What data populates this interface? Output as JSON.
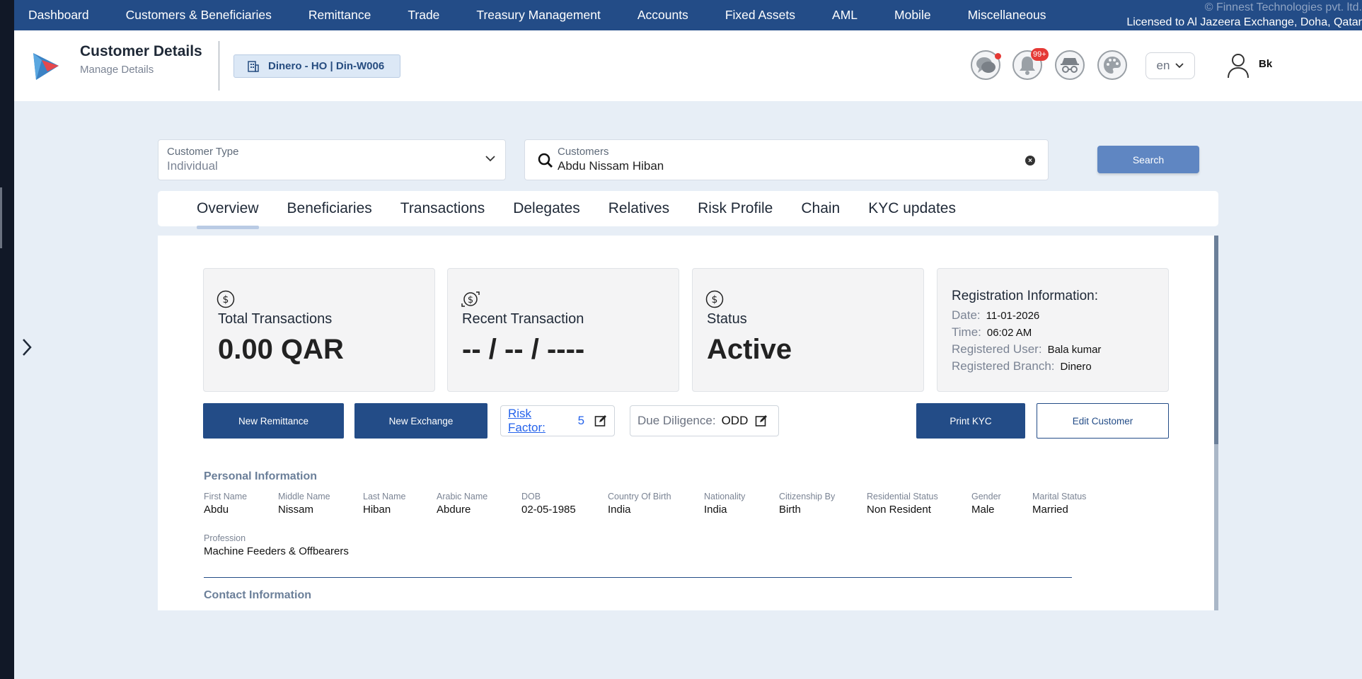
{
  "nav": {
    "items": [
      "Dashboard",
      "Customers & Beneficiaries",
      "Remittance",
      "Trade",
      "Treasury Management",
      "Accounts",
      "Fixed Assets",
      "AML",
      "Mobile",
      "Miscellaneous"
    ],
    "copyright": "©  Finnest Technologies pvt. ltd.",
    "license": "Licensed to Al Jazeera Exchange, Doha, Qatar"
  },
  "header": {
    "title": "Customer Details",
    "subtitle": "Manage Details",
    "branch": "Dinero - HO | Din-W006",
    "notification_badge": "99+",
    "language": "en",
    "user": "Bk"
  },
  "search": {
    "customer_type_label": "Customer Type",
    "customer_type_value": "Individual",
    "customers_label": "Customers",
    "customers_value": "Abdu Nissam Hiban",
    "button": "Search"
  },
  "tabs": [
    "Overview",
    "Beneficiaries",
    "Transactions",
    "Delegates",
    "Relatives",
    "Risk Profile",
    "Chain",
    "KYC updates"
  ],
  "cards": {
    "total": {
      "title": "Total Transactions",
      "value": "0.00 QAR"
    },
    "recent": {
      "title": "Recent Transaction",
      "value": "-- / -- / ----"
    },
    "status": {
      "title": "Status",
      "value": "Active"
    },
    "registration": {
      "title": "Registration Information:",
      "date_label": "Date:",
      "date": "11-01-2026",
      "time_label": "Time:",
      "time": "06:02 AM",
      "user_label": "Registered User:",
      "user": "Bala kumar",
      "branch_label": "Registered Branch:",
      "branch": "Dinero"
    }
  },
  "actions": {
    "new_remittance": "New Remittance",
    "new_exchange": "New Exchange",
    "risk_label": "Risk Factor:",
    "risk_value": "5",
    "dd_label": "Due Diligence:",
    "dd_value": "ODD",
    "print_kyc": "Print KYC",
    "edit_customer": "Edit Customer"
  },
  "personal": {
    "title": "Personal Information",
    "fields": [
      {
        "label": "First Name",
        "value": "Abdu"
      },
      {
        "label": "Middle Name",
        "value": "Nissam"
      },
      {
        "label": "Last Name",
        "value": "Hiban"
      },
      {
        "label": "Arabic Name",
        "value": "Abdure"
      },
      {
        "label": "DOB",
        "value": "02-05-1985"
      },
      {
        "label": "Country Of Birth",
        "value": "India"
      },
      {
        "label": "Nationality",
        "value": "India"
      },
      {
        "label": "Citizenship By",
        "value": "Birth"
      },
      {
        "label": "Residential Status",
        "value": "Non Resident"
      },
      {
        "label": "Gender",
        "value": "Male"
      },
      {
        "label": "Marital Status",
        "value": "Married"
      },
      {
        "label": "Profession",
        "value": "Machine Feeders & Offbearers"
      }
    ]
  },
  "contact": {
    "title": "Contact Information"
  }
}
